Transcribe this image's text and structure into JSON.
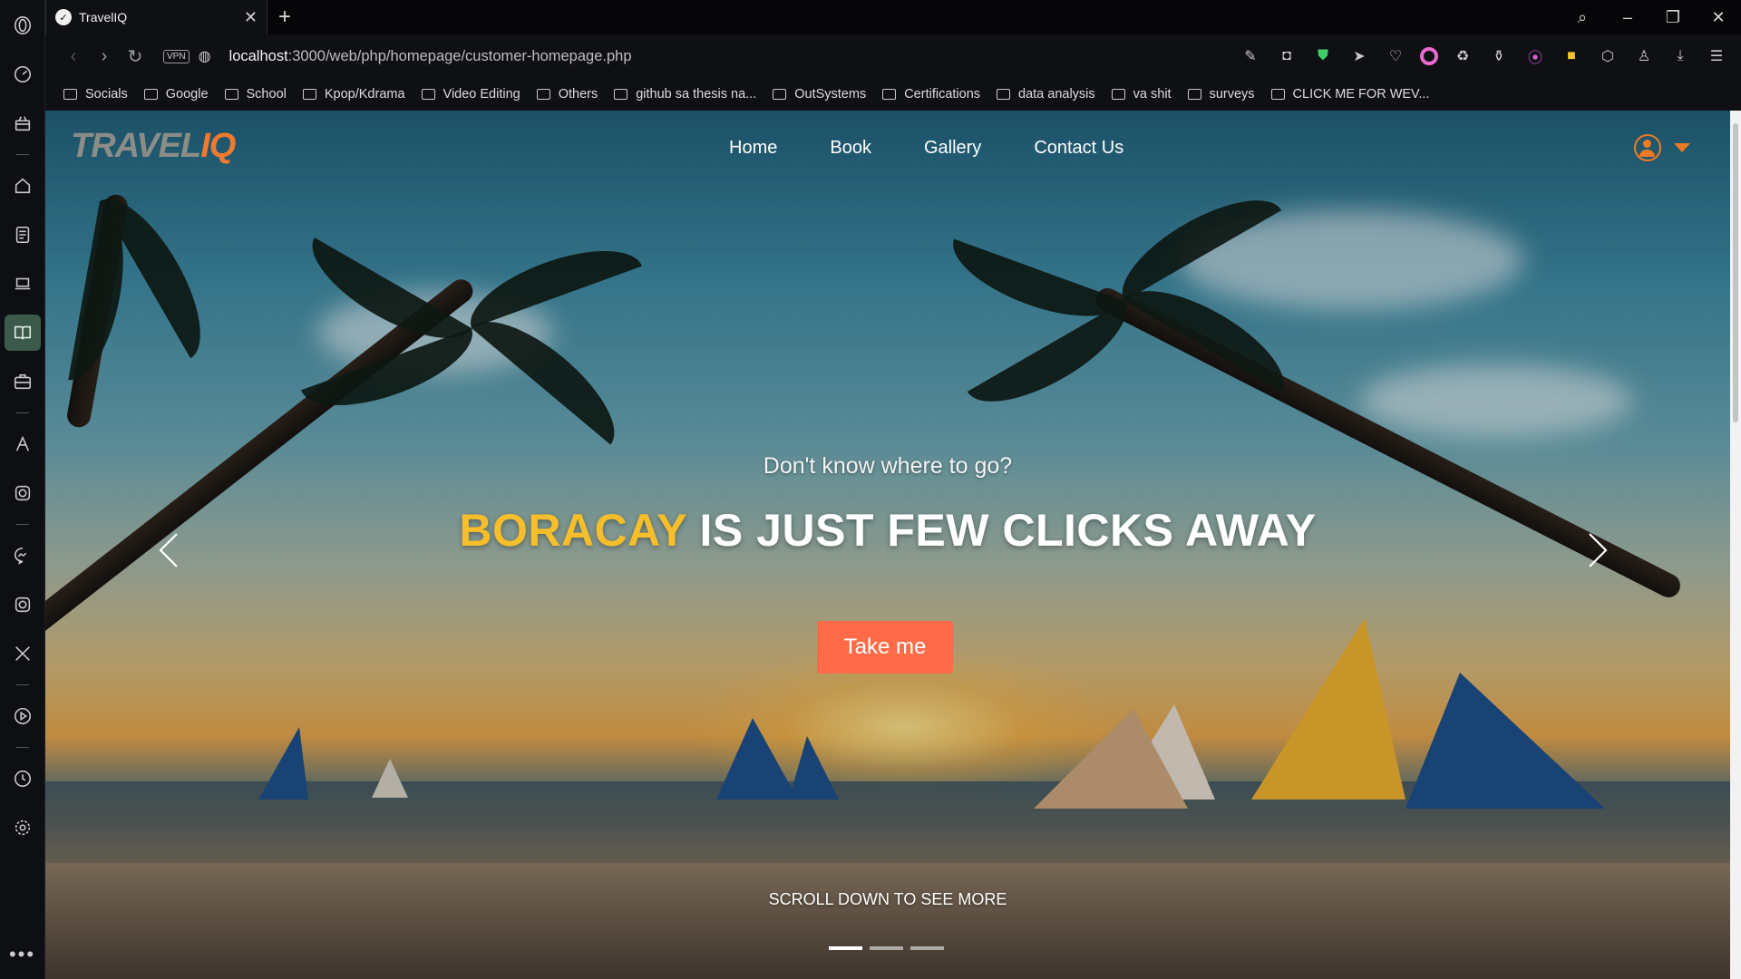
{
  "browser": {
    "tab": {
      "title": "TravelIQ"
    },
    "address": {
      "url_host": "localhost",
      "url_rest": ":3000/web/php/homepage/customer-homepage.php",
      "vpn_label": "VPN"
    },
    "bookmarks": [
      "Socials",
      "Google",
      "School",
      "Kpop/Kdrama",
      "Video Editing",
      "Others",
      "github sa thesis na...",
      "OutSystems",
      "Certifications",
      "data analysis",
      "va shit",
      "surveys",
      "CLICK ME FOR WEV..."
    ]
  },
  "site": {
    "logo_main": "TRAVEL",
    "logo_accent": "IQ",
    "nav": [
      "Home",
      "Book",
      "Gallery",
      "Contact Us"
    ],
    "hero": {
      "subhead": "Don't know where to go?",
      "headline_accent": "BORACAY",
      "headline_rest": " IS JUST FEW CLICKS AWAY",
      "cta": "Take me",
      "scroll_hint": "SCROLL DOWN TO SEE MORE",
      "slides": 3,
      "active_slide": 1
    },
    "colors": {
      "accent_orange": "#ff6b48",
      "headline_yellow": "#f6be2a",
      "logo_orange": "#f27a2e"
    }
  }
}
